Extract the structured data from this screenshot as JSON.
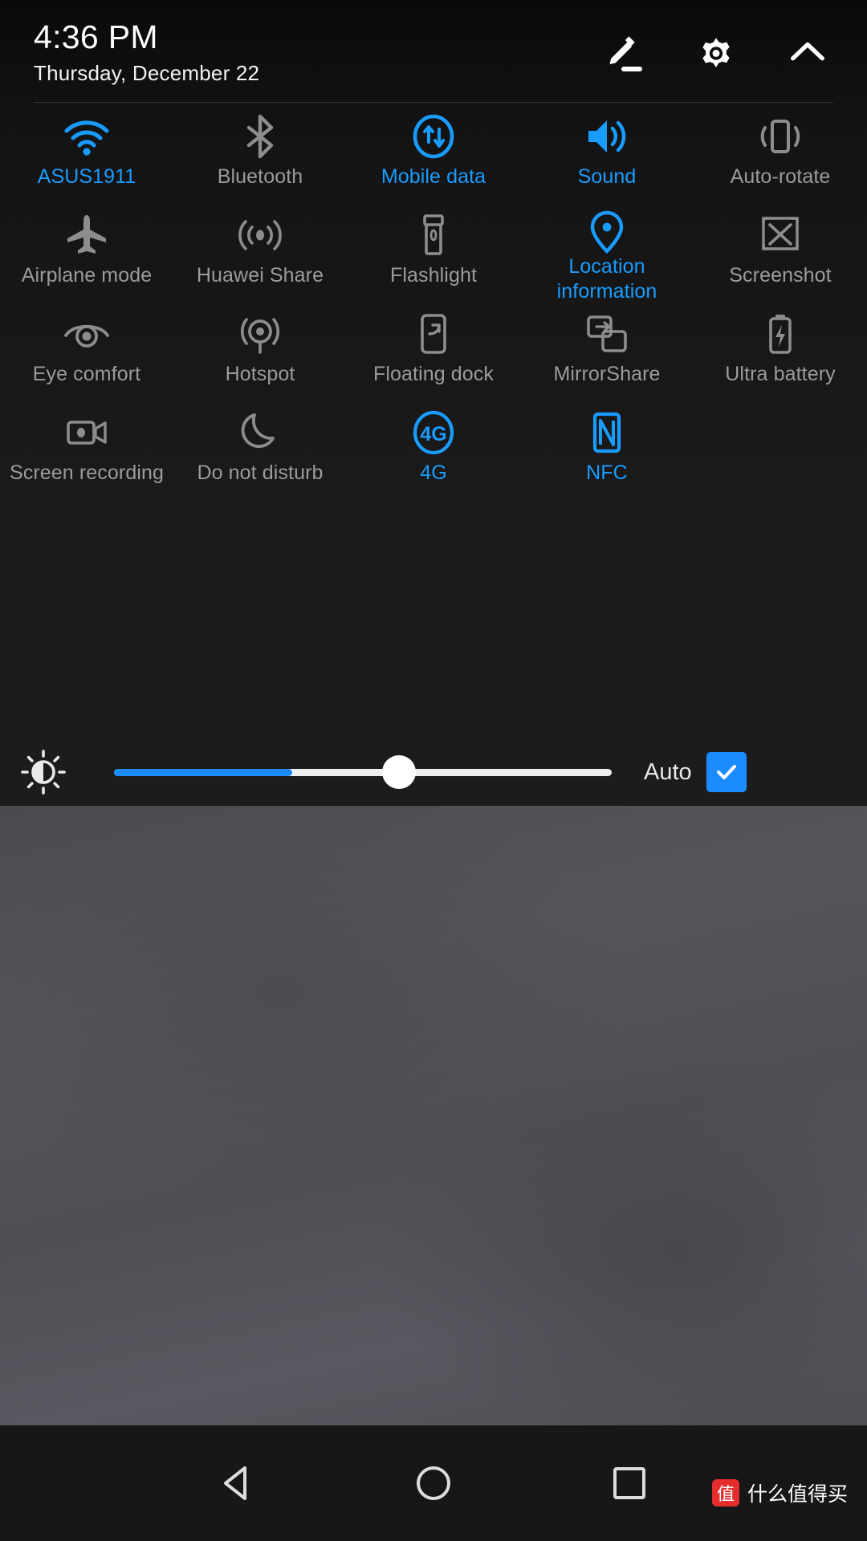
{
  "statusbar": {
    "time": "4:36 PM",
    "date": "Thursday, December 22",
    "icons": [
      {
        "name": "edit-icon",
        "glyph": "pencil"
      },
      {
        "name": "settings-gear-icon",
        "glyph": "gear"
      },
      {
        "name": "collapse-chevron-up-icon",
        "glyph": "chevron-up"
      }
    ]
  },
  "colors": {
    "accent": "#1a9cff",
    "inactive": "#9b9b9b",
    "panel_bg": "#141414",
    "slider_fill": "#1a8cff"
  },
  "tiles": [
    [
      {
        "label": "ASUS1911",
        "icon": "wifi-icon",
        "state": "on"
      },
      {
        "label": "Bluetooth",
        "icon": "bluetooth-icon",
        "state": "off"
      },
      {
        "label": "Mobile data",
        "icon": "mobile-data-icon",
        "state": "on"
      },
      {
        "label": "Sound",
        "icon": "sound-icon",
        "state": "on"
      },
      {
        "label": "Auto-rotate",
        "icon": "auto-rotate-icon",
        "state": "off"
      }
    ],
    [
      {
        "label": "Airplane mode",
        "icon": "airplane-icon",
        "state": "off"
      },
      {
        "label": "Huawei Share",
        "icon": "huawei-share-icon",
        "state": "off"
      },
      {
        "label": "Flashlight",
        "icon": "flashlight-icon",
        "state": "off"
      },
      {
        "label": "Location information",
        "icon": "location-pin-icon",
        "state": "on"
      },
      {
        "label": "Screenshot",
        "icon": "screenshot-icon",
        "state": "off"
      }
    ],
    [
      {
        "label": "Eye comfort",
        "icon": "eye-comfort-icon",
        "state": "off"
      },
      {
        "label": "Hotspot",
        "icon": "hotspot-icon",
        "state": "off"
      },
      {
        "label": "Floating dock",
        "icon": "floating-dock-icon",
        "state": "off"
      },
      {
        "label": "MirrorShare",
        "icon": "mirror-share-icon",
        "state": "off"
      },
      {
        "label": "Ultra battery",
        "icon": "ultra-battery-icon",
        "state": "off"
      }
    ],
    [
      {
        "label": "Screen recording",
        "icon": "screen-record-icon",
        "state": "off"
      },
      {
        "label": "Do not disturb",
        "icon": "do-not-disturb-icon",
        "state": "off"
      },
      {
        "label": "4G",
        "icon": "four-g-icon",
        "state": "on"
      },
      {
        "label": "NFC",
        "icon": "nfc-icon",
        "state": "on"
      },
      {
        "label": "",
        "icon": "",
        "state": "empty"
      }
    ]
  ],
  "brightness": {
    "icon": "brightness-icon",
    "value_percent": 33,
    "auto_label": "Auto",
    "auto_checked": true
  },
  "navbar": {
    "back": "back-triangle-icon",
    "home": "home-circle-icon",
    "recents": "recents-square-icon"
  },
  "watermark": {
    "badge": "值",
    "text": "什么值得买"
  }
}
